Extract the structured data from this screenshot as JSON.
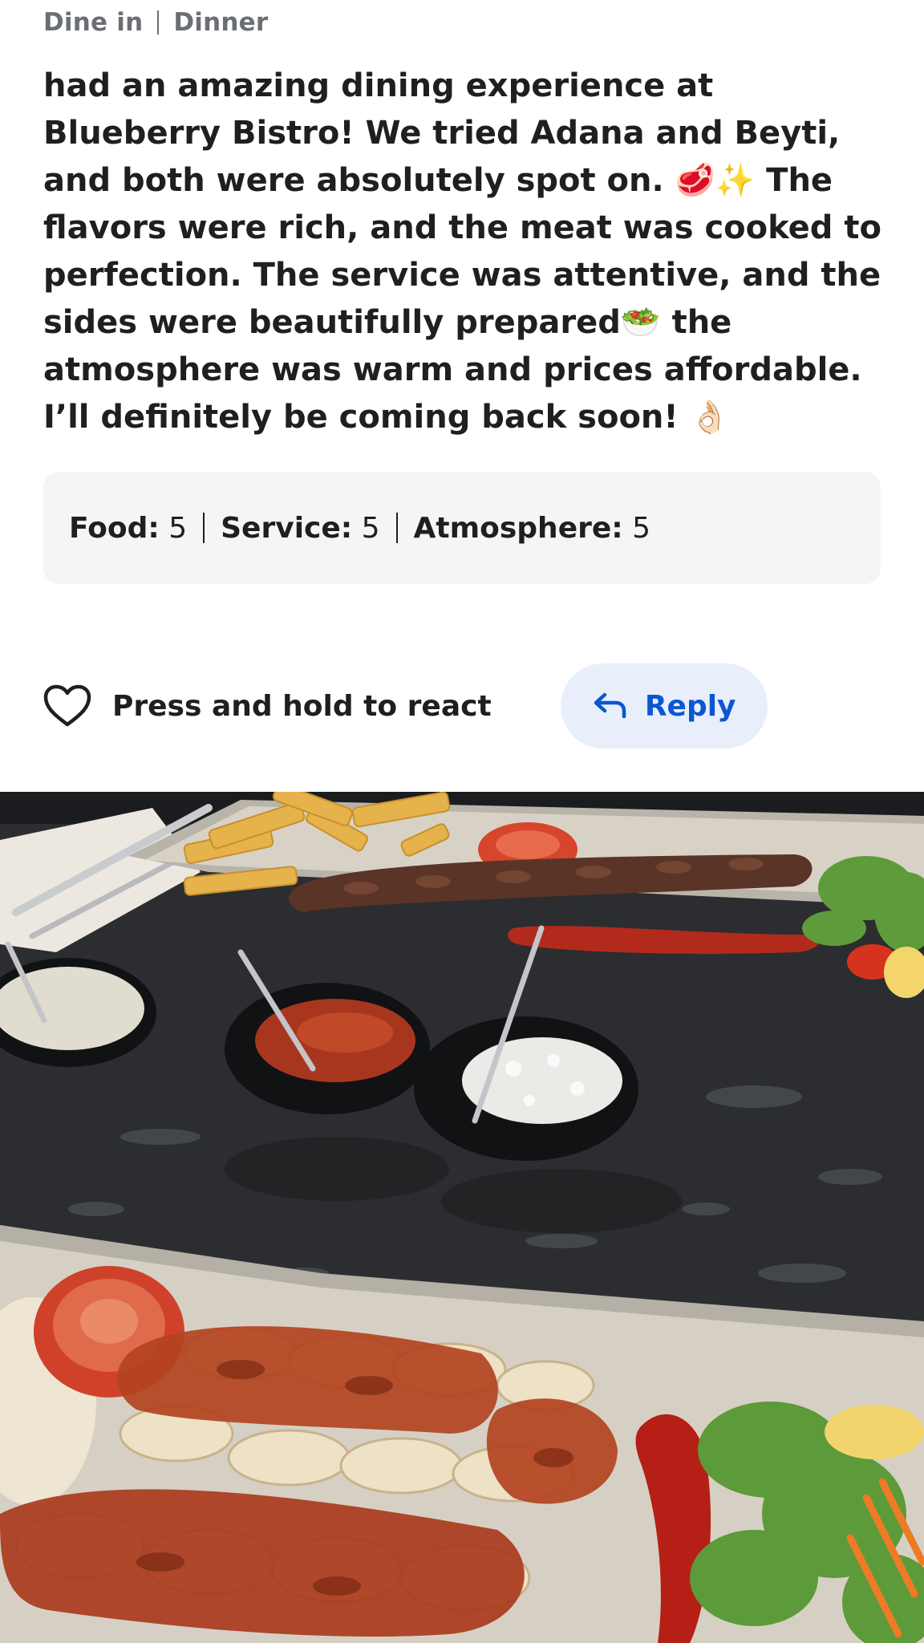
{
  "meta": {
    "service_type": "Dine in",
    "meal": "Dinner"
  },
  "review": {
    "text": "had an amazing dining experience at Blueberry Bistro! We tried Adana and Beyti, and both were absolutely spot on. 🥩✨ The flavors were rich, and the meat was cooked to perfection. The service was attentive, and the sides were beautifully prepared🥗 the atmosphere was warm and prices affordable. I’ll definitely be coming back soon! 👌🏻"
  },
  "ratings": {
    "food_label": "Food:",
    "food_value": "5",
    "service_label": "Service:",
    "service_value": "5",
    "atmosphere_label": "Atmosphere:",
    "atmosphere_value": "5"
  },
  "actions": {
    "react_label": "Press and hold to react",
    "reply_label": "Reply",
    "heart_icon": "heart-outline-icon",
    "reply_icon": "reply-arrow-icon"
  },
  "colors": {
    "accent": "#0b57d0",
    "reply_bg": "#e8effa",
    "ratings_bg": "#f4f5f7",
    "meta_text": "#6b6f74"
  }
}
